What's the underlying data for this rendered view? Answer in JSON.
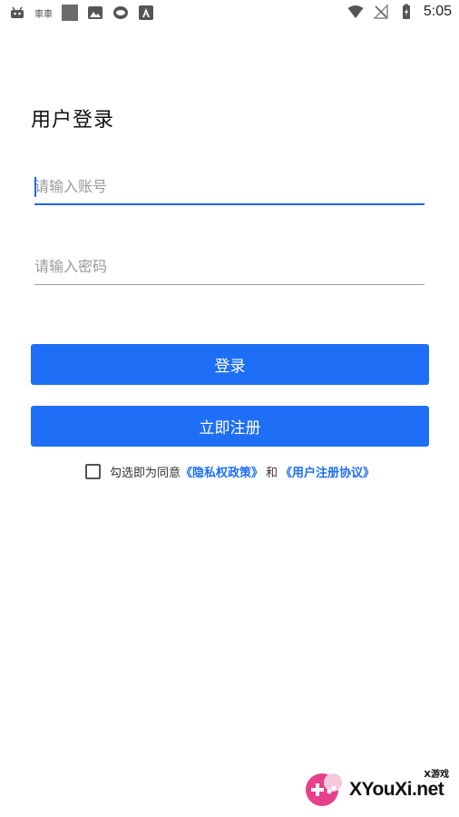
{
  "status_bar": {
    "left_text": "車車",
    "time": "5:05"
  },
  "login": {
    "title": "用户登录",
    "account_placeholder": "请输入账号",
    "password_placeholder": "请输入密码",
    "login_button": "登录",
    "register_button": "立即注册"
  },
  "agreement": {
    "prefix": "勾选即为同意",
    "privacy_link": "《隐私权政策》",
    "conjunction": "和",
    "terms_link": "《用户注册协议》",
    "checked": false
  },
  "watermark": {
    "text": "XYouXi.net",
    "small_text": "X游戏"
  },
  "colors": {
    "accent": "#1e6ff5",
    "background": "#ffffff"
  }
}
